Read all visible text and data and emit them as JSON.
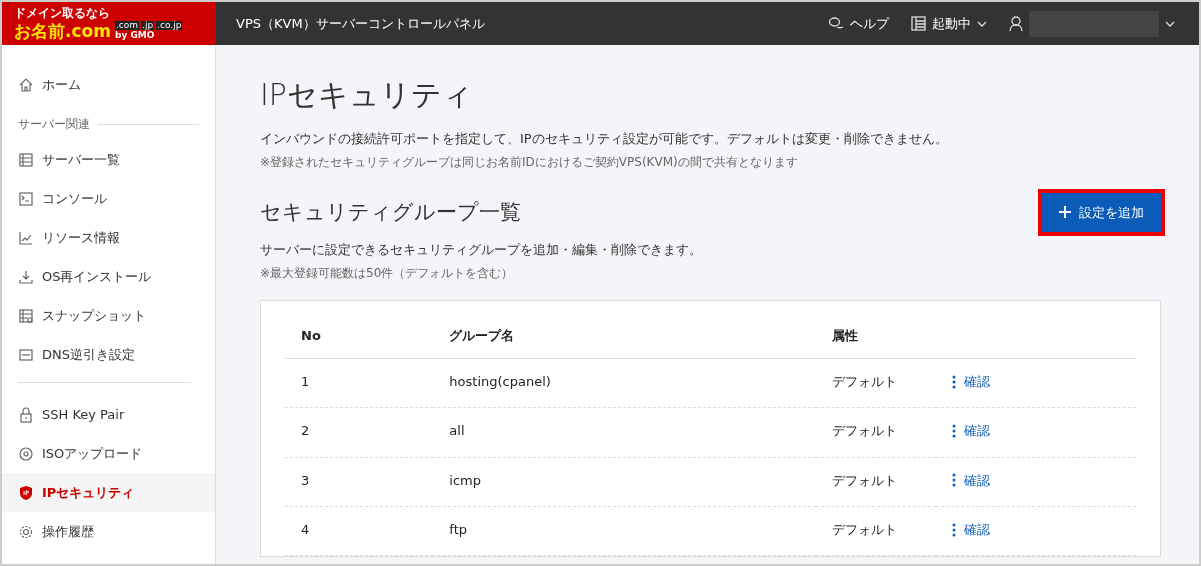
{
  "logo": {
    "tagline": "ドメイン取るなら",
    "name": "お名前.com",
    "domains": [
      ".com",
      ".jp",
      ".co.jp"
    ],
    "by": "by GMO"
  },
  "header": {
    "title": "VPS（KVM）サーバーコントロールパネル",
    "help": "ヘルプ",
    "status": "起動中"
  },
  "sidebar": {
    "items": [
      {
        "kind": "item",
        "label": "ホーム",
        "selected": false
      },
      {
        "kind": "section",
        "label": "サーバー関連"
      },
      {
        "kind": "item",
        "label": "サーバー一覧",
        "selected": false
      },
      {
        "kind": "item",
        "label": "コンソール",
        "selected": false
      },
      {
        "kind": "item",
        "label": "リソース情報",
        "selected": false
      },
      {
        "kind": "item",
        "label": "OS再インストール",
        "selected": false
      },
      {
        "kind": "item",
        "label": "スナップショット",
        "selected": false
      },
      {
        "kind": "item",
        "label": "DNS逆引き設定",
        "selected": false
      },
      {
        "kind": "divider"
      },
      {
        "kind": "item",
        "label": "SSH Key Pair",
        "selected": false
      },
      {
        "kind": "item",
        "label": "ISOアップロード",
        "selected": false
      },
      {
        "kind": "item",
        "label": "IPセキュリティ",
        "selected": true
      },
      {
        "kind": "item",
        "label": "操作履歴",
        "selected": false
      }
    ]
  },
  "page": {
    "title": "IPセキュリティ",
    "description": "インバウンドの接続許可ポートを指定して、IPのセキュリティ設定が可能です。デフォルトは変更・削除できません。",
    "note": "※登録されたセキュリティグループは同じお名前IDにおけるご契約VPS(KVM)の間で共有となります"
  },
  "section": {
    "title": "セキュリティグループ一覧",
    "add_button": {
      "label": "設定を追加",
      "highlighted": true
    },
    "description": "サーバーに設定できるセキュリティグループを追加・編集・削除できます。",
    "note": "※最大登録可能数は50件（デフォルトを含む）"
  },
  "table": {
    "columns": [
      "No",
      "グループ名",
      "属性"
    ],
    "rows": [
      {
        "no": "1",
        "name": "hosting(cpanel)",
        "attribute": "デフォルト",
        "action": "確認"
      },
      {
        "no": "2",
        "name": "all",
        "attribute": "デフォルト",
        "action": "確認"
      },
      {
        "no": "3",
        "name": "icmp",
        "attribute": "デフォルト",
        "action": "確認"
      },
      {
        "no": "4",
        "name": "ftp",
        "attribute": "デフォルト",
        "action": "確認"
      }
    ]
  }
}
